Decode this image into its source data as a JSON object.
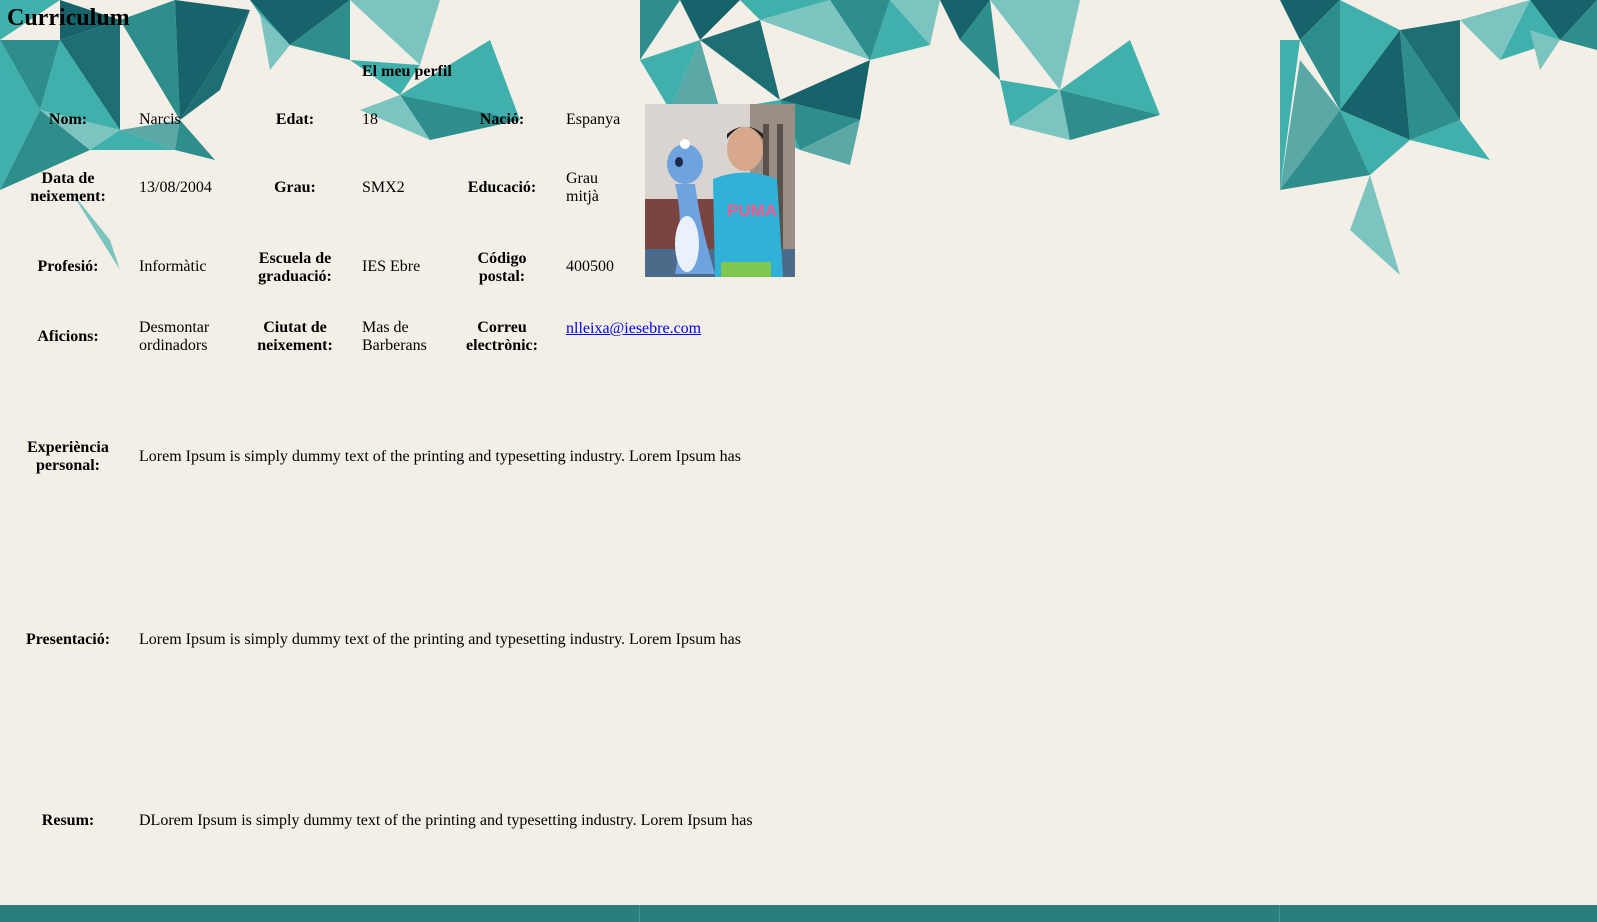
{
  "page": {
    "title": "Curriculum",
    "profile_heading": "El meu perfil"
  },
  "colors": {
    "background": "#f3efe6",
    "teal_dark": "#17636b",
    "teal_mid": "#2e8e8c",
    "teal_light": "#3fb0ac",
    "teal_pale": "#7cc4c0",
    "footer": "#2a7f7c",
    "link": "#0000ee"
  },
  "profile": {
    "row1": {
      "nom_label": "Nom:",
      "nom_value": "Narcis",
      "edat_label": "Edat:",
      "edat_value": "18",
      "nacio_label": "Nació:",
      "nacio_value": "Espanya"
    },
    "row2": {
      "data_label": "Data de neixement:",
      "data_value": "13/08/2004",
      "grau_label": "Grau:",
      "grau_value": "SMX2",
      "educacio_label": "Educació:",
      "educacio_value": "Grau mitjà"
    },
    "row3": {
      "professio_label": "Profesió:",
      "professio_value": "Informàtic",
      "escuela_label": "Escuela de graduació:",
      "escuela_value": "IES Ebre",
      "codigo_label": "Código postal:",
      "codigo_value": "400500"
    },
    "row4": {
      "aficions_label": "Aficions:",
      "aficions_value": "Desmontar ordinadors",
      "ciutat_label": "Ciutat de neixement:",
      "ciutat_value": "Mas de Barberans",
      "correu_label": "Correu electrònic:",
      "correu_value": "nlleixa@iesebre.com"
    }
  },
  "sections": {
    "experiencia_label": "Experiència personal:",
    "experiencia_text": "Lorem Ipsum is simply dummy text of the printing and typesetting industry. Lorem Ipsum has",
    "presentacio_label": "Presentació:",
    "presentacio_text": "Lorem Ipsum is simply dummy text of the printing and typesetting industry. Lorem Ipsum has",
    "resum_label": "Resum:",
    "resum_text": "DLorem Ipsum is simply dummy text of the printing and typesetting industry. Lorem Ipsum has"
  },
  "photo": {
    "icon": "profile-photo"
  }
}
